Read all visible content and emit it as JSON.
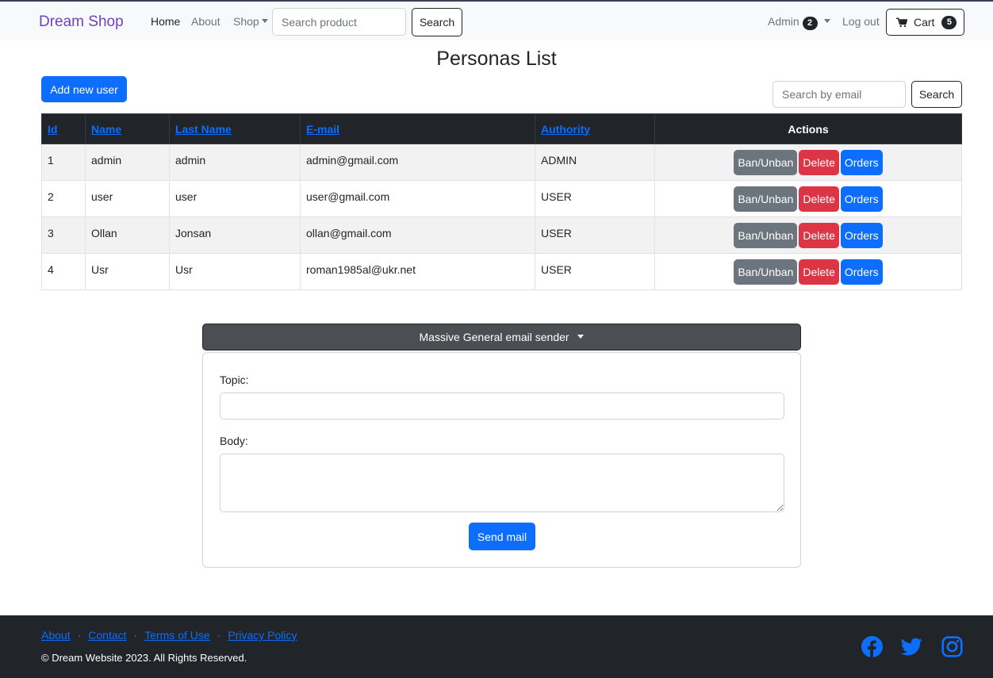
{
  "nav": {
    "brand": "Dream Shop",
    "home": "Home",
    "about": "About",
    "shop": "Shop",
    "search_placeholder": "Search product",
    "search_button": "Search",
    "admin_label": "Admin",
    "admin_badge": "2",
    "logout": "Log out",
    "cart_label": "Cart",
    "cart_badge": "5"
  },
  "page": {
    "title": "Personas List",
    "add_user": "Add new user",
    "email_search_placeholder": "Search by email",
    "email_search_button": "Search"
  },
  "table": {
    "headers": {
      "id": "Id",
      "name": "Name",
      "last_name": "Last Name",
      "email": "E-mail",
      "authority": "Authority",
      "actions": "Actions"
    },
    "action_labels": {
      "ban": "Ban/Unban",
      "delete": "Delete",
      "orders": "Orders"
    },
    "rows": [
      {
        "id": "1",
        "name": "admin",
        "last_name": "admin",
        "email": "admin@gmail.com",
        "authority": "ADMIN"
      },
      {
        "id": "2",
        "name": "user",
        "last_name": "user",
        "email": "user@gmail.com",
        "authority": "USER"
      },
      {
        "id": "3",
        "name": "Ollan",
        "last_name": "Jonsan",
        "email": "ollan@gmail.com",
        "authority": "USER"
      },
      {
        "id": "4",
        "name": "Usr",
        "last_name": "Usr",
        "email": "roman1985al@ukr.net",
        "authority": "USER"
      }
    ]
  },
  "sender": {
    "toggle": "Massive General email sender",
    "topic_label": "Topic:",
    "topic_value": "",
    "body_label": "Body:",
    "body_value": "",
    "send": "Send mail"
  },
  "footer": {
    "links": [
      "About",
      "Contact",
      "Terms of Use",
      "Privacy Policy"
    ],
    "separator": "·",
    "copyright": "© Dream Website 2023. All Rights Reserved.",
    "social_icons": [
      "facebook-icon",
      "twitter-icon",
      "instagram-icon"
    ]
  },
  "colors": {
    "primary": "#0d6efd",
    "danger": "#dc3545",
    "secondary": "#6c757d",
    "dark": "#212529",
    "brand": "#6f42c1"
  }
}
